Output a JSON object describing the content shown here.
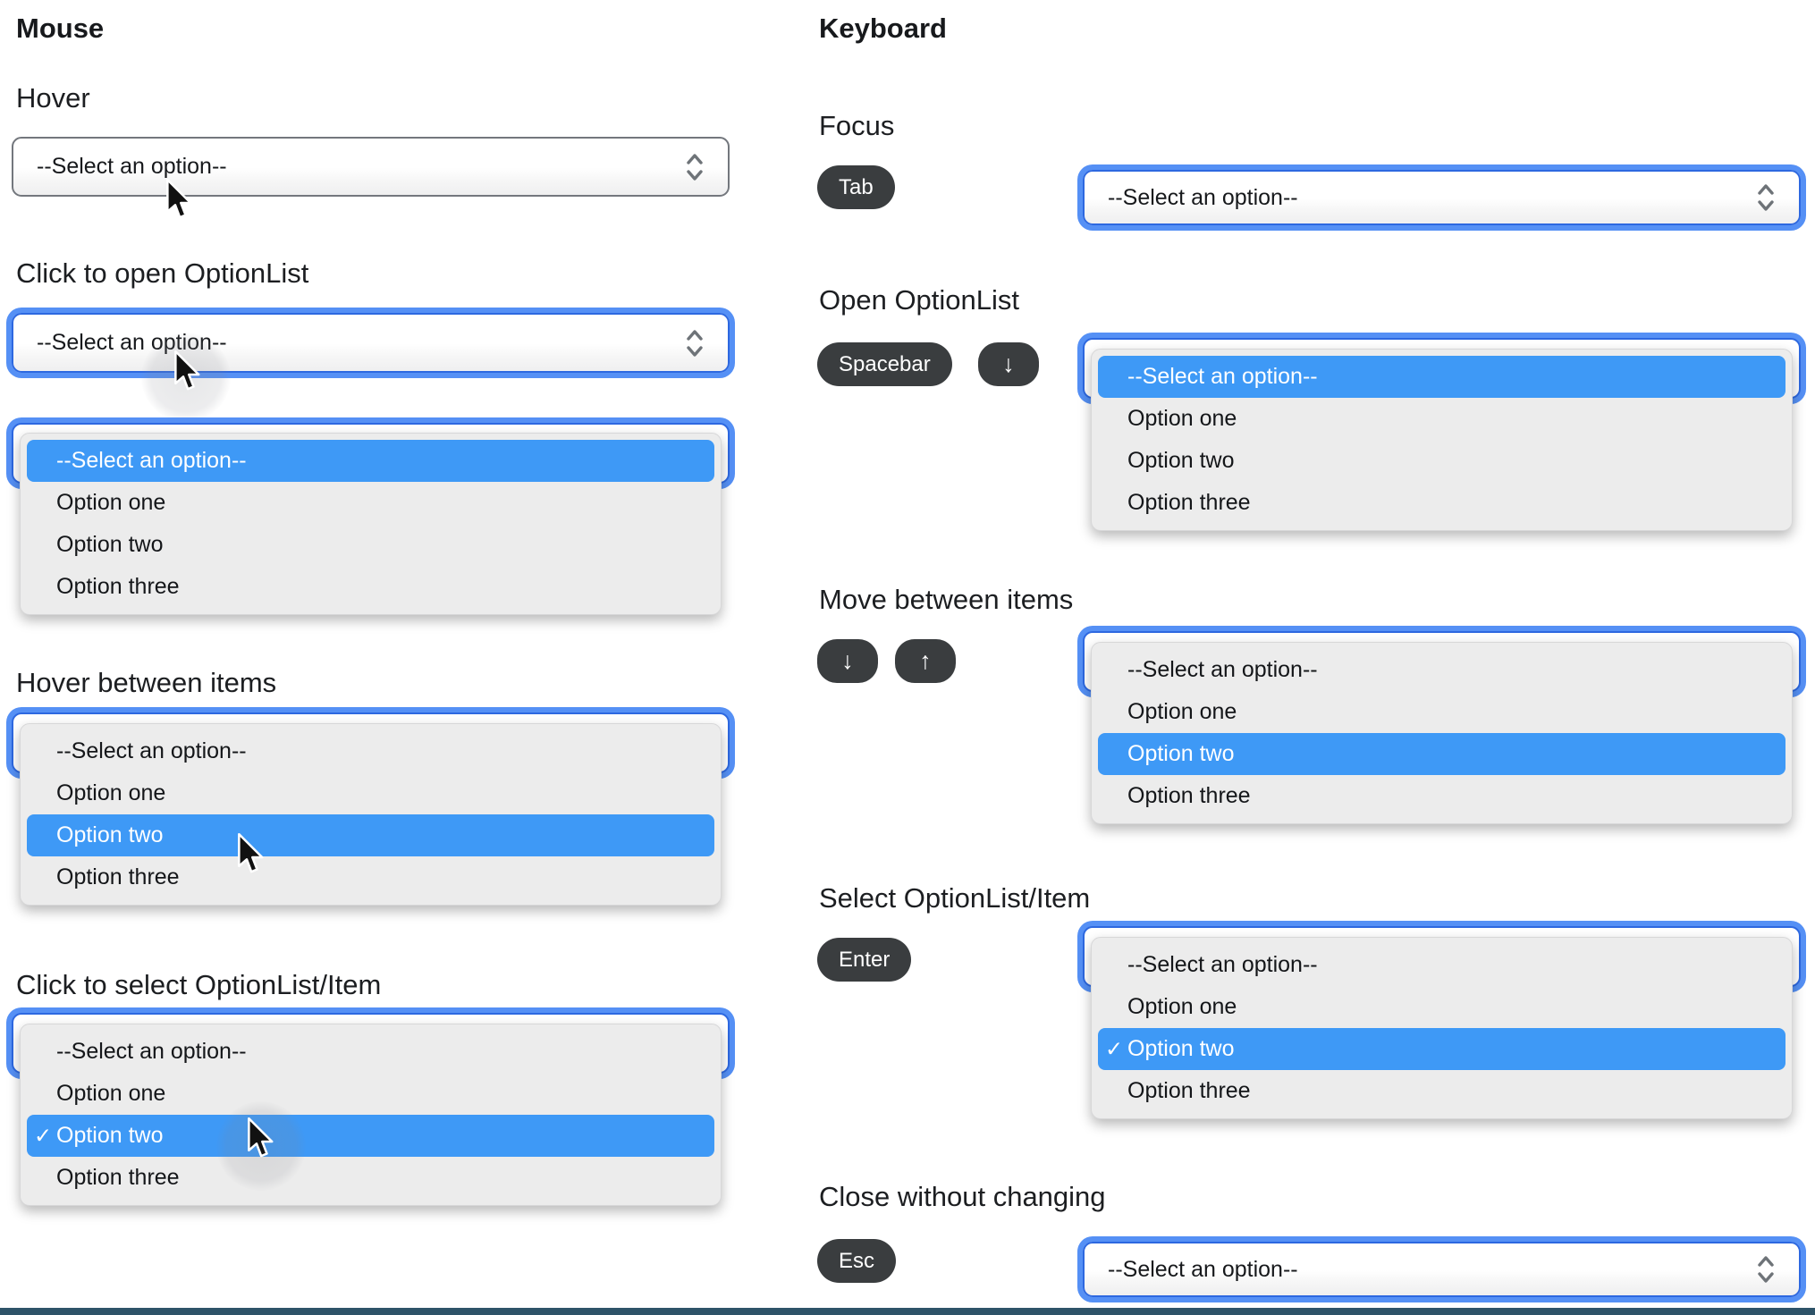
{
  "headings": {
    "mouse": "Mouse",
    "keyboard": "Keyboard"
  },
  "select": {
    "placeholder": "--Select an option--"
  },
  "glyphs": {
    "check": "✓",
    "arrow_down": "↓",
    "arrow_up": "↑"
  },
  "mouse_sections": {
    "hover": {
      "title": "Hover"
    },
    "click_open": {
      "title": "Click to open OptionList"
    },
    "hover_items": {
      "title": "Hover between items"
    },
    "click_select": {
      "title": "Click to select OptionList/Item"
    }
  },
  "keyboard_sections": {
    "focus": {
      "title": "Focus",
      "keys": {
        "tab": "Tab"
      }
    },
    "open": {
      "title": "Open OptionList",
      "keys": {
        "spacebar": "Spacebar",
        "down": "↓"
      }
    },
    "move": {
      "title": "Move between items",
      "keys": {
        "down": "↓",
        "up": "↑"
      }
    },
    "select": {
      "title": "Select OptionList/Item",
      "keys": {
        "enter": "Enter"
      }
    },
    "close": {
      "title": "Close without changing",
      "keys": {
        "esc": "Esc"
      }
    }
  },
  "panels": {
    "mouse_click_open": {
      "items": [
        {
          "label": "--Select an option--",
          "state": "highlighted"
        },
        {
          "label": "Option one",
          "state": "normal"
        },
        {
          "label": "Option two",
          "state": "normal"
        },
        {
          "label": "Option three",
          "state": "normal"
        }
      ]
    },
    "mouse_hover_items": {
      "items": [
        {
          "label": "--Select an option--",
          "state": "normal"
        },
        {
          "label": "Option one",
          "state": "normal"
        },
        {
          "label": "Option two",
          "state": "highlighted"
        },
        {
          "label": "Option three",
          "state": "normal"
        }
      ]
    },
    "mouse_click_select": {
      "items": [
        {
          "label": "--Select an option--",
          "state": "normal"
        },
        {
          "label": "Option one",
          "state": "normal"
        },
        {
          "label": "Option two",
          "state": "highlighted-checked"
        },
        {
          "label": "Option three",
          "state": "normal"
        }
      ]
    },
    "kb_open": {
      "items": [
        {
          "label": "--Select an option--",
          "state": "highlighted"
        },
        {
          "label": "Option one",
          "state": "normal"
        },
        {
          "label": "Option two",
          "state": "normal"
        },
        {
          "label": "Option three",
          "state": "normal"
        }
      ]
    },
    "kb_move": {
      "items": [
        {
          "label": "--Select an option--",
          "state": "normal"
        },
        {
          "label": "Option one",
          "state": "normal"
        },
        {
          "label": "Option two",
          "state": "highlighted"
        },
        {
          "label": "Option three",
          "state": "normal"
        }
      ]
    },
    "kb_select": {
      "items": [
        {
          "label": "--Select an option--",
          "state": "normal"
        },
        {
          "label": "Option one",
          "state": "normal"
        },
        {
          "label": "Option two",
          "state": "highlighted-checked"
        },
        {
          "label": "Option three",
          "state": "normal"
        }
      ]
    }
  },
  "colors": {
    "highlight_blue": "#3e99f6",
    "focus_ring": "#5590f5",
    "focus_border": "#2d68e0",
    "panel_gray": "#ececec",
    "key_badge": "#3a3d3f",
    "select_border": "#73777d",
    "bottom_line": "#2e5368"
  }
}
